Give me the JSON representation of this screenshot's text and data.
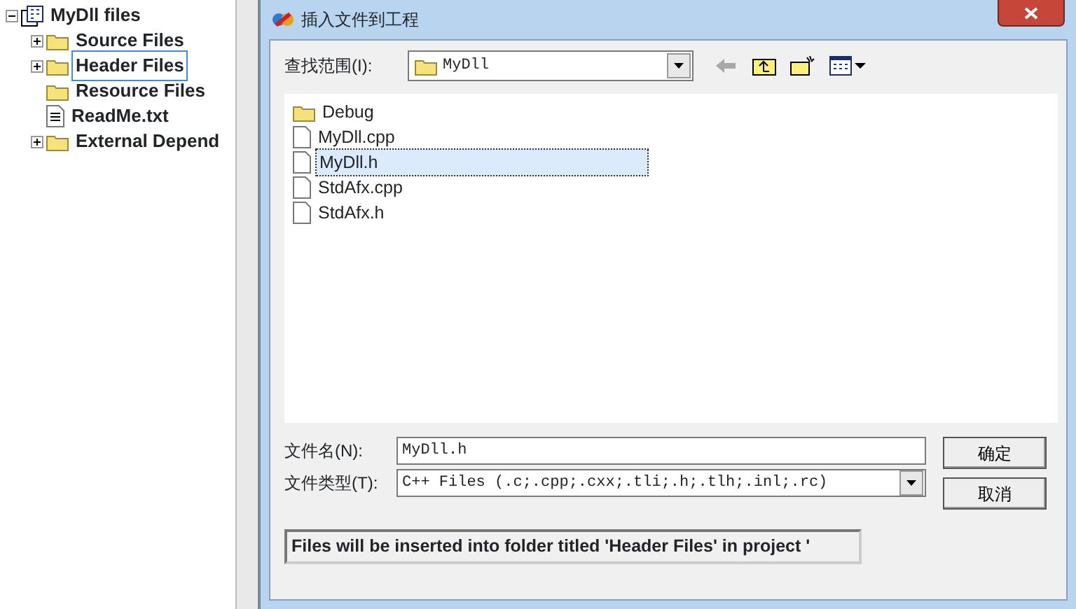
{
  "tree": [
    {
      "label": "MyDll files",
      "kind": "project",
      "collapsible": true,
      "expanded": true,
      "selected": false,
      "children": [
        {
          "label": "Source Files",
          "kind": "folder",
          "collapsible": true,
          "expanded": false,
          "selected": false
        },
        {
          "label": "Header Files",
          "kind": "folder",
          "collapsible": true,
          "expanded": false,
          "selected": true
        },
        {
          "label": "Resource Files",
          "kind": "folder",
          "collapsible": false,
          "selected": false
        },
        {
          "label": "ReadMe.txt",
          "kind": "text",
          "collapsible": false,
          "selected": false
        },
        {
          "label": "External Depend",
          "kind": "folder",
          "collapsible": true,
          "expanded": false,
          "selected": false
        }
      ]
    }
  ],
  "dialog": {
    "title": "插入文件到工程",
    "look_in": {
      "label": "查找范围(I):",
      "value": "MyDll"
    },
    "files": [
      {
        "name": "Debug",
        "kind": "folder",
        "selected": false
      },
      {
        "name": "MyDll.cpp",
        "kind": "file",
        "selected": false
      },
      {
        "name": "MyDll.h",
        "kind": "file",
        "selected": true
      },
      {
        "name": "StdAfx.cpp",
        "kind": "file",
        "selected": false
      },
      {
        "name": "StdAfx.h",
        "kind": "file",
        "selected": false
      }
    ],
    "file_name": {
      "label": "文件名(N):",
      "value": "MyDll.h"
    },
    "file_type": {
      "label": "文件类型(T):",
      "value": "C++ Files (.c;.cpp;.cxx;.tli;.h;.tlh;.inl;.rc)"
    },
    "buttons": [
      "确定",
      "取消"
    ],
    "status": "Files will be inserted into folder titled 'Header Files' in project '"
  }
}
